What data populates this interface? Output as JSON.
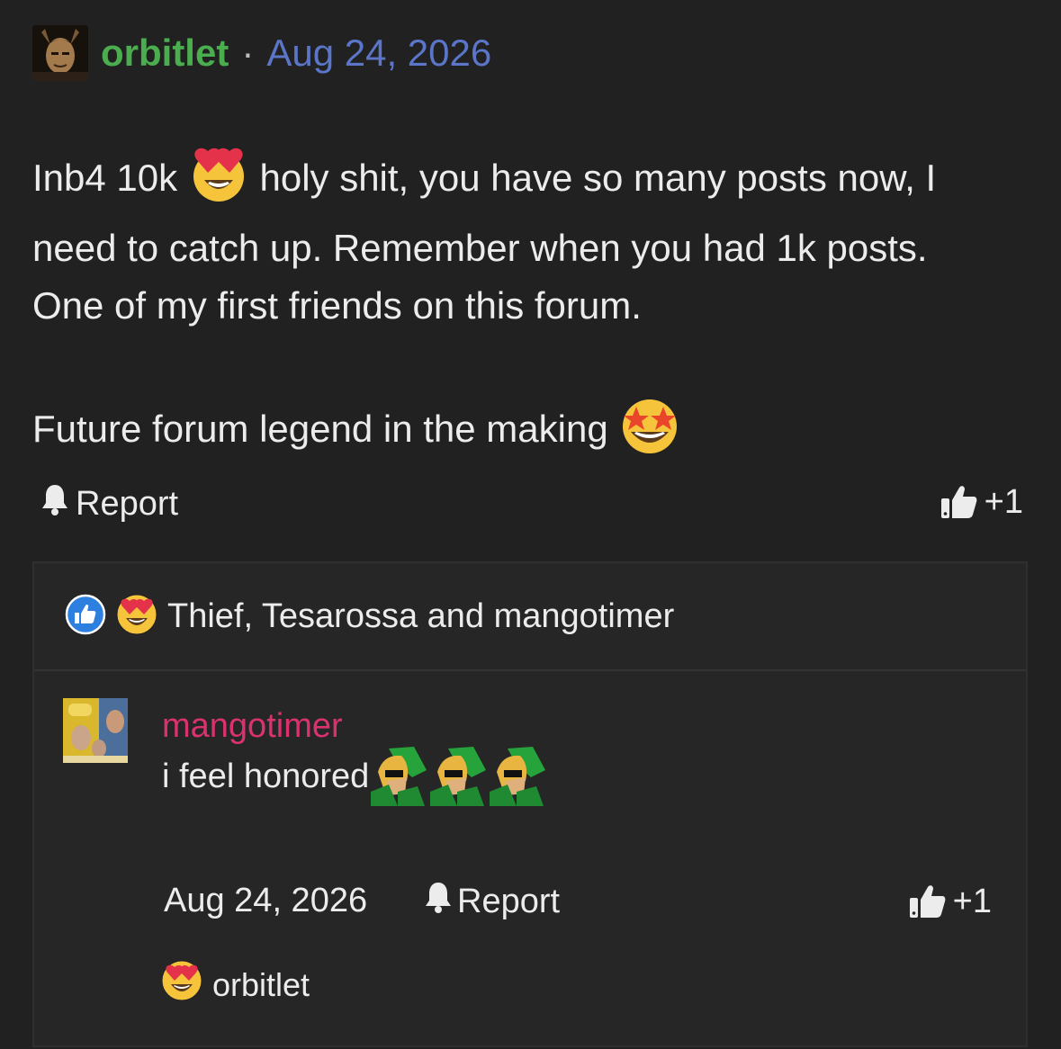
{
  "post": {
    "author": "orbitlet",
    "separator": "·",
    "date": "Aug 24, 2026",
    "body_line1_before": "Inb4 10k",
    "body_line1_after": "holy shit, you have so many posts now, I",
    "body_line2": "need to catch up. Remember when you had 1k posts.",
    "body_line3": "One of my first friends on this forum.",
    "body_para2": "Future forum legend in the making",
    "report_label": "Report",
    "like_count": "+1"
  },
  "reactions": {
    "names": "Thief, Tesarossa and mangotimer"
  },
  "reply": {
    "author": "mangotimer",
    "text": "i feel honored",
    "date": "Aug 24, 2026",
    "report_label": "Report",
    "like_count": "+1",
    "reaction_names": "orbitlet"
  },
  "colors": {
    "background": "#212121",
    "author_green": "#4aae4f",
    "date_blue": "#5b76c9",
    "reply_author_pink": "#d9326f"
  },
  "icons": {
    "bell": "bell-icon",
    "like": "thumbs-up-icon",
    "heart_eyes": "heart-eyes-emoji",
    "star_struck": "star-struck-emoji"
  }
}
